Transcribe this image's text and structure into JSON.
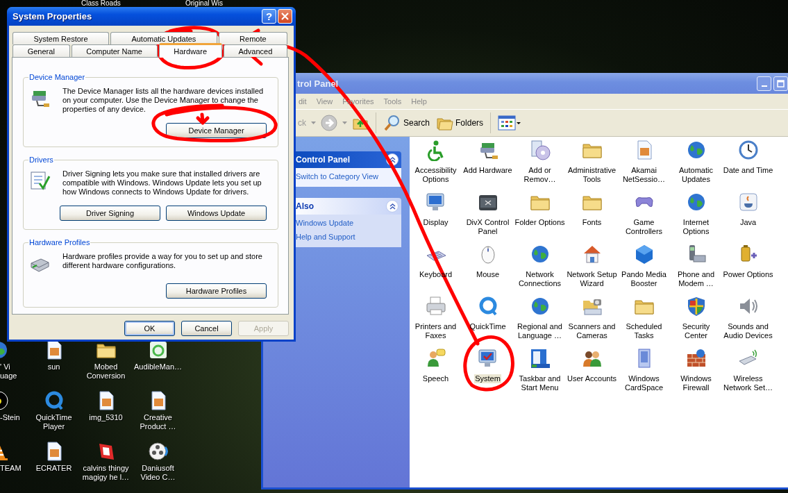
{
  "desktop": {
    "top_labels": [
      "Class Roads",
      "Original Wis"
    ],
    "icons": [
      {
        "label": "' Vi uage"
      },
      {
        "label": "sun"
      },
      {
        "label": "Mobed Conversion"
      },
      {
        "label": "AudibleMan…"
      },
      {
        "label": "-Stein"
      },
      {
        "label": "QuickTime Player"
      },
      {
        "label": "img_5310"
      },
      {
        "label": "Creative Product …"
      },
      {
        "label": "TEAM"
      },
      {
        "label": "ECRATER"
      },
      {
        "label": "calvins thingy magigy he l…"
      },
      {
        "label": "Daniusoft Video C…"
      }
    ]
  },
  "control_panel": {
    "title": "trol Panel",
    "menu": [
      "dit",
      "View",
      "Favorites",
      "Tools",
      "Help"
    ],
    "toolbar": {
      "back_label": "ck",
      "search_label": "Search",
      "folders_label": "Folders"
    },
    "task_panes": [
      {
        "kind": "primary",
        "title": "Control Panel",
        "expanded": true,
        "links": [
          "Switch to Category View"
        ]
      },
      {
        "kind": "normal",
        "title": "Also",
        "expanded": true,
        "links": [
          "Windows Update",
          "Help and Support"
        ]
      }
    ],
    "items": [
      {
        "label": "Accessibility Options",
        "selected": false
      },
      {
        "label": "Add Hardware",
        "selected": false
      },
      {
        "label": "Add or Remov…",
        "selected": false
      },
      {
        "label": "Administrative Tools",
        "selected": false
      },
      {
        "label": "Akamai NetSessio…",
        "selected": false
      },
      {
        "label": "Automatic Updates",
        "selected": false
      },
      {
        "label": "Date and Time",
        "selected": false
      },
      {
        "label": "Display",
        "selected": false
      },
      {
        "label": "DivX Control Panel",
        "selected": false
      },
      {
        "label": "Folder Options",
        "selected": false
      },
      {
        "label": "Fonts",
        "selected": false
      },
      {
        "label": "Game Controllers",
        "selected": false
      },
      {
        "label": "Internet Options",
        "selected": false
      },
      {
        "label": "Java",
        "selected": false
      },
      {
        "label": "Keyboard",
        "selected": false
      },
      {
        "label": "Mouse",
        "selected": false
      },
      {
        "label": "Network Connections",
        "selected": false
      },
      {
        "label": "Network Setup Wizard",
        "selected": false
      },
      {
        "label": "Pando Media Booster",
        "selected": false
      },
      {
        "label": "Phone and Modem …",
        "selected": false
      },
      {
        "label": "Power Options",
        "selected": false
      },
      {
        "label": "Printers and Faxes",
        "selected": false
      },
      {
        "label": "QuickTime",
        "selected": false
      },
      {
        "label": "Regional and Language …",
        "selected": false
      },
      {
        "label": "Scanners and Cameras",
        "selected": false
      },
      {
        "label": "Scheduled Tasks",
        "selected": false
      },
      {
        "label": "Security Center",
        "selected": false
      },
      {
        "label": "Sounds and Audio Devices",
        "selected": false
      },
      {
        "label": "Speech",
        "selected": false
      },
      {
        "label": "System",
        "selected": true
      },
      {
        "label": "Taskbar and Start Menu",
        "selected": false
      },
      {
        "label": "User Accounts",
        "selected": false
      },
      {
        "label": "Windows CardSpace",
        "selected": false
      },
      {
        "label": "Windows Firewall",
        "selected": false
      },
      {
        "label": "Wireless Network Set…",
        "selected": false
      }
    ]
  },
  "system_properties": {
    "title": "System Properties",
    "help_label": "?",
    "tab_rows": [
      [
        {
          "label": "System Restore",
          "selected": false
        },
        {
          "label": "Automatic Updates",
          "selected": false
        },
        {
          "label": "Remote",
          "selected": false
        }
      ],
      [
        {
          "label": "General",
          "selected": false
        },
        {
          "label": "Computer Name",
          "selected": false
        },
        {
          "label": "Hardware",
          "selected": true
        },
        {
          "label": "Advanced",
          "selected": false
        }
      ]
    ],
    "groups": [
      {
        "title": "Device Manager",
        "text": "The Device Manager lists all the hardware devices installed on your computer. Use the Device Manager to change the properties of any device.",
        "buttons": [
          "Device Manager"
        ]
      },
      {
        "title": "Drivers",
        "text": "Driver Signing lets you make sure that installed drivers are compatible with Windows. Windows Update lets you set up how Windows connects to Windows Update for drivers.",
        "buttons": [
          "Driver Signing",
          "Windows Update"
        ]
      },
      {
        "title": "Hardware Profiles",
        "text": "Hardware profiles provide a way for you to set up and store different hardware configurations.",
        "buttons": [
          "Hardware Profiles"
        ]
      }
    ],
    "buttons": [
      {
        "label": "OK",
        "disabled": false
      },
      {
        "label": "Cancel",
        "disabled": false
      },
      {
        "label": "Apply",
        "disabled": true
      }
    ]
  }
}
